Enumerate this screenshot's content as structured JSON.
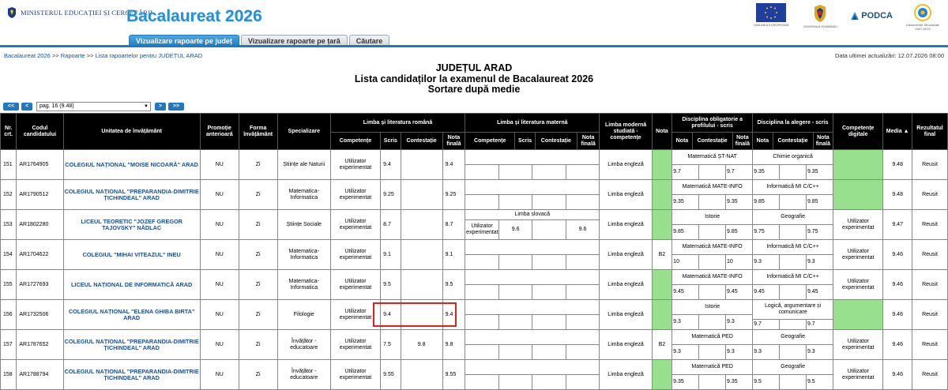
{
  "header": {
    "ministry": "MINISTERUL EDUCAȚIEI ȘI CERCETĂRII",
    "app_title": "Bacalaureat 2026",
    "logos": [
      {
        "icon": "eu-flag-icon",
        "caption": "UNIUNEA EUROPEANĂ"
      },
      {
        "icon": "romania-coat-of-arms-icon",
        "caption": "GUVERNUL ROMÂNIEI"
      },
      {
        "icon": "podca-logo-icon",
        "caption": "PODCA"
      },
      {
        "icon": "structural-funds-icon",
        "caption": "Instrumente Structurale 2007-2013"
      }
    ]
  },
  "tabs": [
    {
      "label": "Vizualizare rapoarte pe județ",
      "active": true
    },
    {
      "label": "Vizualizare rapoarte pe țară",
      "active": false
    },
    {
      "label": "Căutare",
      "active": false
    }
  ],
  "breadcrumb": {
    "items": [
      "Bacalaureat 2026",
      "Rapoarte",
      "Lista rapoartelor pentru JUDEȚUL ARAD"
    ],
    "separator": ">>"
  },
  "updated": "Data ultimei actualizări: 12.07.2026 08:00",
  "heading": {
    "line1": "JUDEȚUL ARAD",
    "line2": "Lista candidaților la examenul de Bacalaureat 2026",
    "line3": "Sortare după medie"
  },
  "pager": {
    "first": "<<",
    "prev": "<",
    "next": ">",
    "last": ">>",
    "selected": "pag. 16 (9.48)"
  },
  "columns": {
    "nr": "Nr. crt.",
    "code": "Codul candidatului",
    "unit": "Unitatea de învățământ",
    "promo": "Promoție anterioară",
    "form": "Forma învățământ",
    "spec": "Specializare",
    "lrom": "Limba și literatura română",
    "lmat": "Limba și literatura maternă",
    "lmod": "Limba modernă studiată - competențe",
    "nota": "Nota",
    "dob": "Disciplina obligatorie a profilului - scris",
    "dal": "Disciplina la alegere - scris",
    "dig": "Competențe digitale",
    "media": "Media",
    "rez": "Rezultatul final",
    "sub_comp": "Competențe",
    "sub_scris": "Scris",
    "sub_cont": "Contestație",
    "sub_final": "Nota finală",
    "sub_nota": "Nota",
    "sort_icon": "sort-up-icon"
  },
  "rows": [
    {
      "nr": "151",
      "code": "AR1764905",
      "unit": "COLEGIUL NAȚIONAL \"MOISE NICOARĂ\" ARAD",
      "promo": "NU",
      "form": "Zi",
      "spec": "Științe ale Naturii",
      "rom_comp": "Utilizator experimentat",
      "rom_scris": "9.4",
      "rom_cont": "",
      "rom_final": "9.4",
      "mat_name": "",
      "mat_comp": "",
      "mat_scris": "",
      "mat_cont": "",
      "mat_final": "",
      "lmod": "Limba engleză",
      "lnota": "",
      "lgreen": true,
      "dob_name": "Matematică ȘT-NAT",
      "dob_nota": "9.7",
      "dob_cont": "",
      "dob_final": "9.7",
      "dal_name": "Chimie organică",
      "dal_nota": "9.35",
      "dal_cont": "",
      "dal_final": "9.35",
      "dig": "",
      "dgreen": true,
      "media": "9.48",
      "rez": "Reusit"
    },
    {
      "nr": "152",
      "code": "AR1790512",
      "unit": "COLEGIUL NAȚIONAL \"PREPARANDIA-DIMITRIE ȚICHINDEAL\" ARAD",
      "promo": "NU",
      "form": "Zi",
      "spec": "Matematica-Informatica",
      "rom_comp": "Utilizator experimentat",
      "rom_scris": "9.25",
      "rom_cont": "",
      "rom_final": "9.25",
      "mat_name": "",
      "mat_comp": "",
      "mat_scris": "",
      "mat_cont": "",
      "mat_final": "",
      "lmod": "Limba engleză",
      "lnota": "",
      "lgreen": true,
      "dob_name": "Matematică MATE-INFO",
      "dob_nota": "9.35",
      "dob_cont": "",
      "dob_final": "9.35",
      "dal_name": "Informatică MI C/C++",
      "dal_nota": "9.85",
      "dal_cont": "",
      "dal_final": "9.85",
      "dig": "",
      "dgreen": true,
      "media": "9.48",
      "rez": "Reusit"
    },
    {
      "nr": "153",
      "code": "AR1802280",
      "unit": "LICEUL TEORETIC \"JOZEF GREGOR TAJOVSKY\" NĂDLAC",
      "promo": "NU",
      "form": "Zi",
      "spec": "Științe Sociale",
      "rom_comp": "Utilizator experimentat",
      "rom_scris": "8.7",
      "rom_cont": "",
      "rom_final": "8.7",
      "mat_name": "Limba slovacă",
      "mat_comp": "Utilizator experimentat",
      "mat_scris": "9.6",
      "mat_cont": "",
      "mat_final": "9.6",
      "lmod": "Limba engleză",
      "lnota": "",
      "lgreen": true,
      "dob_name": "Istorie",
      "dob_nota": "9.85",
      "dob_cont": "",
      "dob_final": "9.85",
      "dal_name": "Geografie",
      "dal_nota": "9.75",
      "dal_cont": "",
      "dal_final": "9.75",
      "dig": "Utilizator experimentat",
      "dgreen": false,
      "media": "9.47",
      "rez": "Reusit"
    },
    {
      "nr": "154",
      "code": "AR1704622",
      "unit": "COLEGIUL \"MIHAI VITEAZUL\" INEU",
      "promo": "NU",
      "form": "Zi",
      "spec": "Matematica-Informatica",
      "rom_comp": "Utilizator experimentat",
      "rom_scris": "9.1",
      "rom_cont": "",
      "rom_final": "9.1",
      "mat_name": "",
      "mat_comp": "",
      "mat_scris": "",
      "mat_cont": "",
      "mat_final": "",
      "lmod": "Limba engleză",
      "lnota": "B2",
      "lgreen": false,
      "dob_name": "Matematică MATE-INFO",
      "dob_nota": "10",
      "dob_cont": "",
      "dob_final": "10",
      "dal_name": "Informatică MI C/C++",
      "dal_nota": "9.3",
      "dal_cont": "",
      "dal_final": "9.3",
      "dig": "Utilizator experimentat",
      "dgreen": false,
      "media": "9.46",
      "rez": "Reusit"
    },
    {
      "nr": "155",
      "code": "AR1727693",
      "unit": "LICEUL NAȚIONAL DE INFORMATICĂ ARAD",
      "promo": "NU",
      "form": "Zi",
      "spec": "Matematica-Informatica",
      "rom_comp": "Utilizator experimentat",
      "rom_scris": "9.5",
      "rom_cont": "",
      "rom_final": "9.5",
      "mat_name": "",
      "mat_comp": "",
      "mat_scris": "",
      "mat_cont": "",
      "mat_final": "",
      "lmod": "Limba engleză",
      "lnota": "",
      "lgreen": true,
      "dob_name": "Matematică MATE-INFO",
      "dob_nota": "9.45",
      "dob_cont": "",
      "dob_final": "9.45",
      "dal_name": "Informatică MI C/C++",
      "dal_nota": "9.45",
      "dal_cont": "",
      "dal_final": "9.45",
      "dig": "Utilizator experimentat",
      "dgreen": false,
      "media": "9.46",
      "rez": "Reusit"
    },
    {
      "nr": "156",
      "code": "AR1732506",
      "unit": "COLEGIUL NAȚIONAL \"ELENA GHIBA BIRTA\" ARAD",
      "promo": "NU",
      "form": "Zi",
      "spec": "Filologie",
      "rom_comp": "Utilizator experimentat",
      "rom_scris": "9.4",
      "rom_cont": "",
      "rom_final": "9.4",
      "mat_name": "",
      "mat_comp": "",
      "mat_scris": "",
      "mat_cont": "",
      "mat_final": "",
      "lmod": "Limba engleză",
      "lnota": "",
      "lgreen": true,
      "dob_name": "Istorie",
      "dob_nota": "9.3",
      "dob_cont": "",
      "dob_final": "9.3",
      "dal_name": "Logică, argumentare și comunicare",
      "dal_nota": "9.7",
      "dal_cont": "",
      "dal_final": "9.7",
      "dig": "",
      "dgreen": true,
      "media": "9.46",
      "rez": "Reusit"
    },
    {
      "nr": "157",
      "code": "AR1787652",
      "unit": "COLEGIUL NAȚIONAL \"PREPARANDIA-DIMITRIE ȚICHINDEAL\" ARAD",
      "promo": "NU",
      "form": "Zi",
      "spec": "Învățător - educatoare",
      "rom_comp": "Utilizator experimentat",
      "rom_scris": "7.5",
      "rom_cont": "9.8",
      "rom_final": "9.8",
      "mat_name": "",
      "mat_comp": "",
      "mat_scris": "",
      "mat_cont": "",
      "mat_final": "",
      "lmod": "Limba engleză",
      "lnota": "B2",
      "lgreen": false,
      "dob_name": "Matematică PED",
      "dob_nota": "9.3",
      "dob_cont": "",
      "dob_final": "9.3",
      "dal_name": "Geografie",
      "dal_nota": "9.3",
      "dal_cont": "",
      "dal_final": "9.3",
      "dig": "Utilizator experimentat",
      "dgreen": false,
      "media": "9.46",
      "rez": "Reusit"
    },
    {
      "nr": "158",
      "code": "AR1788794",
      "unit": "COLEGIUL NAȚIONAL \"PREPARANDIA-DIMITRIE ȚICHINDEAL\" ARAD",
      "promo": "NU",
      "form": "Zi",
      "spec": "Învățător - educatoare",
      "rom_comp": "Utilizator experimentat",
      "rom_scris": "9.55",
      "rom_cont": "",
      "rom_final": "9.55",
      "mat_name": "",
      "mat_comp": "",
      "mat_scris": "",
      "mat_cont": "",
      "mat_final": "",
      "lmod": "Limba engleză",
      "lnota": "",
      "lgreen": true,
      "dob_name": "Matematică PED",
      "dob_nota": "9.35",
      "dob_cont": "",
      "dob_final": "9.35",
      "dal_name": "Geografie",
      "dal_nota": "9.5",
      "dal_cont": "",
      "dal_final": "9.5",
      "dig": "Utilizator experimentat",
      "dgreen": false,
      "media": "9.46",
      "rez": "Reusit"
    }
  ]
}
